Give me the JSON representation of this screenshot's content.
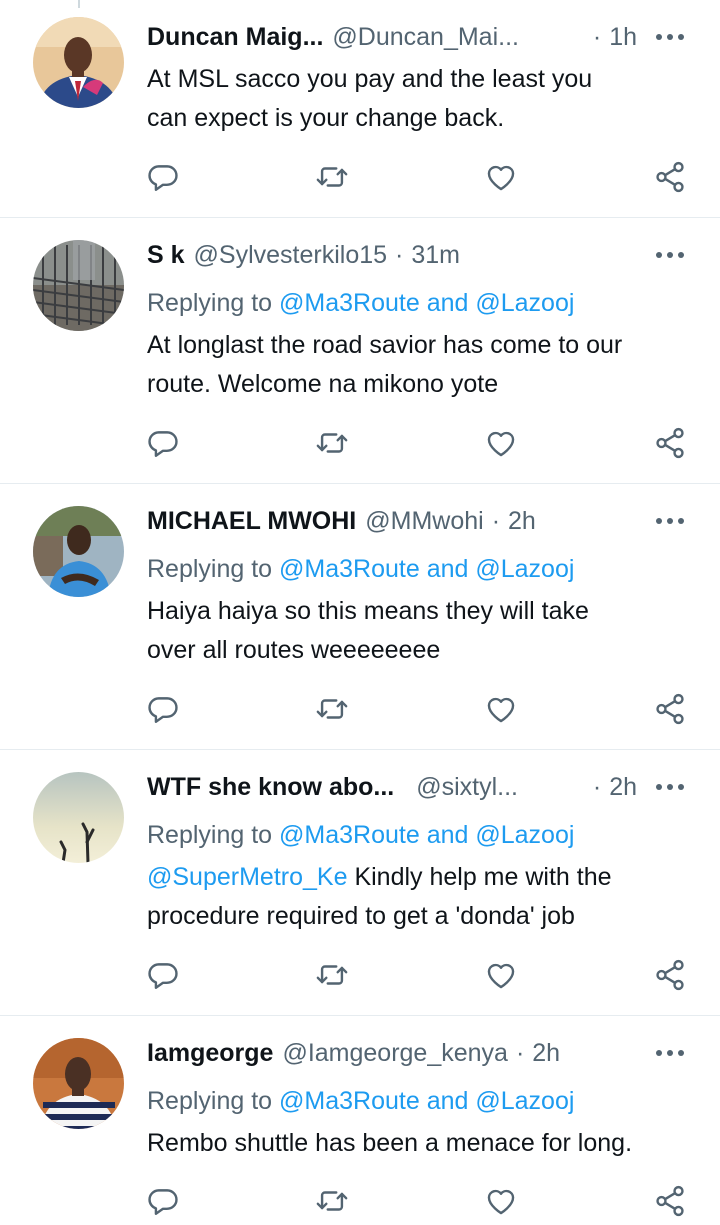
{
  "tweets": [
    {
      "name": "Duncan Maig...",
      "handle": "@Duncan_Mai...",
      "time": "1h",
      "replying_label": "",
      "replying_to": "",
      "text_lines": [
        "At MSL sacco you pay and the least you",
        "can expect is your change back."
      ],
      "avatar": "avatar-man-red-tie"
    },
    {
      "name": "S k",
      "handle": "@Sylvesterkilo15",
      "time": "31m",
      "replying_label": "Replying to",
      "replying_to": "@Ma3Route and @Lazooj",
      "text_lines": [
        "At longlast the road savior has come to our",
        "route. Welcome na mikono yote"
      ],
      "avatar": "avatar-rebar-construction"
    },
    {
      "name": "MICHAEL MWOHI",
      "handle": "@MMwohi",
      "time": "2h",
      "replying_label": "Replying to",
      "replying_to": "@Ma3Route and @Lazooj",
      "text_lines": [
        "Haiya haiya so this means they will take",
        "over all routes weeeeeeee"
      ],
      "avatar": "avatar-man-blue-shirt"
    },
    {
      "name": "WTF she know abo...",
      "handle": "@sixtyl...",
      "time": "2h",
      "replying_label": "Replying to",
      "replying_to": "@Ma3Route and @Lazooj",
      "mention": "@SuperMetro_Ke",
      "text_lines": [
        "Kindly help me with the",
        "procedure required to get a 'donda' job"
      ],
      "avatar": "avatar-sunset-silhouette"
    },
    {
      "name": "Iamgeorge",
      "handle": "@Iamgeorge_kenya",
      "time": "2h",
      "replying_label": "Replying to",
      "replying_to": "@Ma3Route and @Lazooj",
      "text_lines": [
        "Rembo shuttle has been a menace for long."
      ],
      "avatar": "avatar-man-striped-shirt"
    }
  ],
  "icons": {
    "more": "more-dots-icon",
    "reply": "reply-icon",
    "retweet": "retweet-icon",
    "like": "like-icon",
    "share": "share-icon"
  },
  "colors": {
    "link": "#1d9bf0",
    "muted": "#536471",
    "text": "#0f1419",
    "divider": "#e6ecf0"
  }
}
